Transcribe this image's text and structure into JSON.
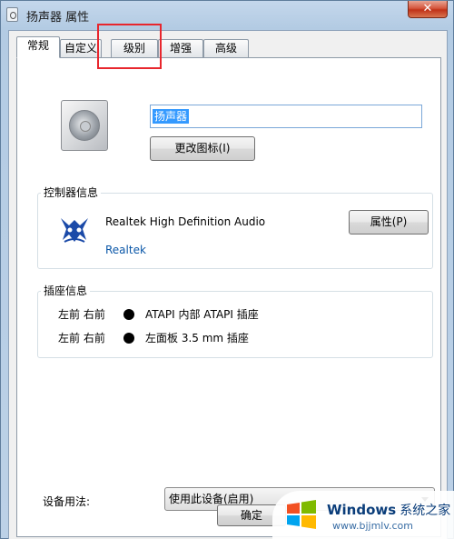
{
  "window": {
    "title": "扬声器 属性",
    "close_glyph": "✕"
  },
  "tabs": [
    {
      "label": "常规",
      "active": true
    },
    {
      "label": "自定义",
      "active": false
    },
    {
      "label": "级别",
      "active": false
    },
    {
      "label": "增强",
      "active": false
    },
    {
      "label": "高级",
      "active": false
    }
  ],
  "general": {
    "device_icon": "speaker-icon",
    "device_name_value": "扬声器",
    "change_icon_label": "更改图标(I)"
  },
  "controller": {
    "group_title": "控制器信息",
    "logo": "realtek-logo-icon",
    "name": "Realtek High Definition Audio",
    "vendor": "Realtek",
    "properties_label": "属性(P)"
  },
  "jacks": {
    "group_title": "插座信息",
    "rows": [
      {
        "position": "左前 右前",
        "description": "ATAPI 内部 ATAPI 插座"
      },
      {
        "position": "左前 右前",
        "description": "左面板 3.5 mm 插座"
      }
    ]
  },
  "usage": {
    "label": "设备用法:",
    "selected": "使用此设备(启用)"
  },
  "footer": {
    "ok_label": "确定"
  },
  "watermark": {
    "brand": "Windows",
    "brand_cn": "系统之家",
    "url": "www.bjjmlv.com"
  },
  "colors": {
    "highlight": "#e8262d",
    "selection": "#3399ff",
    "link": "#0b57a8"
  }
}
